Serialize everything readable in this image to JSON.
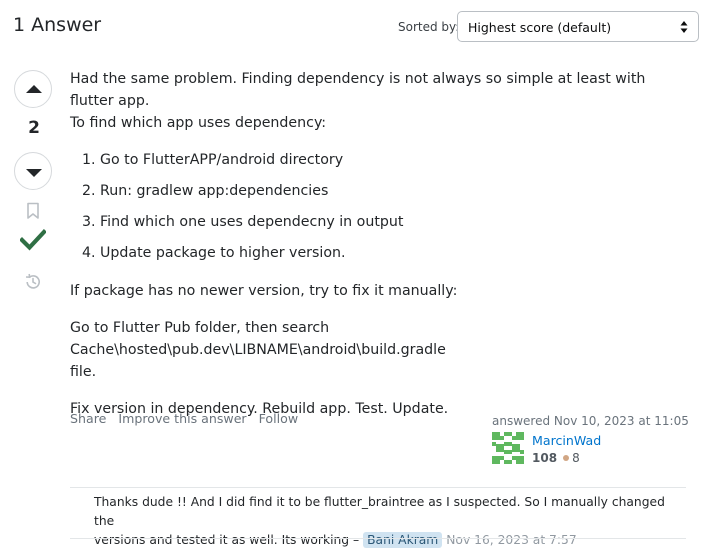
{
  "header": {
    "answers_count": "1 Answer",
    "sort_label": "Sorted by:",
    "sort_value": "Highest score (default)"
  },
  "votes": {
    "score": "2",
    "accepted": true
  },
  "answer": {
    "intro_line1": "Had the same problem. Finding dependency is not always so simple at least with flutter app.",
    "intro_line2": "To find which app uses dependency:",
    "steps": [
      "Go to FlutterAPP/android directory",
      "Run: gradlew app:dependencies",
      "Find which one uses dependecny in output",
      "Update package to higher version."
    ],
    "para2": "If package has no newer version, try to fix it manually:",
    "para3_line1": "Go to Flutter Pub folder, then search Cache\\hosted\\pub.dev\\LIBNAME\\android\\build.gradle",
    "para3_line2": "file.",
    "para4": "Fix version in dependency. Rebuild app. Test. Update."
  },
  "post_menu": {
    "share": "Share",
    "improve": "Improve this answer",
    "follow": "Follow"
  },
  "user_card": {
    "answered": "answered Nov 10, 2023 at 11:05",
    "name": "MarcinWad",
    "reputation": "108",
    "bronze": "8",
    "avatar_color": "#5fb85f"
  },
  "comment": {
    "text_line1": "Thanks dude !! And I did find it to be flutter_braintree as I suspected. So I manually changed the",
    "text_line2": "versions and tested it as well. Its working –",
    "user": "Bani Akram",
    "date": "Nov 16, 2023 at 7:57"
  },
  "colors": {
    "accepted": "#2f6f44",
    "link": "#0074cc"
  }
}
